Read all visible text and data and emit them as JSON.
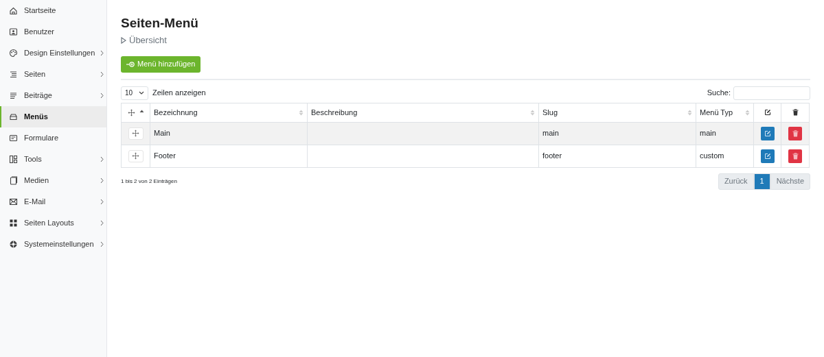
{
  "sidebar": {
    "items": [
      {
        "label": "Startseite",
        "expandable": false,
        "selected": false
      },
      {
        "label": "Benutzer",
        "expandable": false,
        "selected": false
      },
      {
        "label": "Design Einstellungen",
        "expandable": true,
        "selected": false
      },
      {
        "label": "Seiten",
        "expandable": true,
        "selected": false
      },
      {
        "label": "Beiträge",
        "expandable": true,
        "selected": false
      },
      {
        "label": "Menüs",
        "expandable": false,
        "selected": true
      },
      {
        "label": "Formulare",
        "expandable": false,
        "selected": false
      },
      {
        "label": "Tools",
        "expandable": true,
        "selected": false
      },
      {
        "label": "Medien",
        "expandable": true,
        "selected": false
      },
      {
        "label": "E-Mail",
        "expandable": true,
        "selected": false
      },
      {
        "label": "Seiten Layouts",
        "expandable": true,
        "selected": false
      },
      {
        "label": "Systemeinstellungen",
        "expandable": true,
        "selected": false
      }
    ]
  },
  "page": {
    "title": "Seiten-Menü",
    "breadcrumb": "Übersicht",
    "add_button": "Menü hinzufügen"
  },
  "length": {
    "value": "10",
    "label": "Zeilen anzeigen"
  },
  "search": {
    "label": "Suche:"
  },
  "table": {
    "columns": [
      {
        "kind": "drag",
        "sortable": true,
        "sorted": true
      },
      {
        "kind": "text",
        "label": "Bezeichnung",
        "sortable": true,
        "sorted": false
      },
      {
        "kind": "text",
        "label": "Beschreibung",
        "sortable": true,
        "sorted": false
      },
      {
        "kind": "text",
        "label": "Slug",
        "sortable": true,
        "sorted": false
      },
      {
        "kind": "text",
        "label": "Menü Typ",
        "sortable": true,
        "sorted": false
      },
      {
        "kind": "edit",
        "sortable": false
      },
      {
        "kind": "delete",
        "sortable": false
      }
    ],
    "rows": [
      {
        "name": "Main",
        "slug": "main",
        "type": "main"
      },
      {
        "name": "Footer",
        "slug": "footer",
        "type": "custom"
      }
    ]
  },
  "info": "1 bis 2 von 2 Einträgen",
  "pagination": [
    {
      "label": "Zurück",
      "disabled": true,
      "selected": false
    },
    {
      "label": "1",
      "selected": true
    },
    {
      "label": "Nächste",
      "disabled": true,
      "selected": false
    }
  ]
}
